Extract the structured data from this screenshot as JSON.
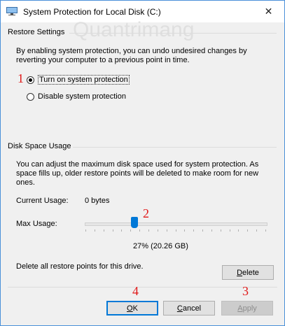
{
  "window": {
    "title": "System Protection for Local Disk (C:)",
    "close_glyph": "✕",
    "accent_color": "#0078d7",
    "watermark": "Quantrimang"
  },
  "restore_settings": {
    "group_label": "Restore Settings",
    "description": "By enabling system protection, you can undo undesired changes by reverting your computer to a previous point in time.",
    "options": [
      {
        "label": "Turn on system protection",
        "checked": true
      },
      {
        "label": "Disable system protection",
        "checked": false
      }
    ]
  },
  "disk_space": {
    "group_label": "Disk Space Usage",
    "description": "You can adjust the maximum disk space used for system protection. As space fills up, older restore points will be deleted to make room for new ones.",
    "current_usage_label": "Current Usage:",
    "current_usage_value": "0 bytes",
    "max_usage_label": "Max Usage:",
    "max_usage_fraction": 0.27,
    "max_usage_readout": "27% (20.26 GB)",
    "delete_text": "Delete all restore points for this drive.",
    "delete_button": {
      "accel": "D",
      "rest": "elete"
    }
  },
  "buttons": {
    "ok": {
      "accel": "O",
      "rest": "K"
    },
    "cancel": {
      "accel": "C",
      "rest": "ancel"
    },
    "apply": {
      "accel": "A",
      "rest": "pply",
      "disabled": true
    }
  },
  "annotations": [
    "1",
    "2",
    "3",
    "4"
  ]
}
